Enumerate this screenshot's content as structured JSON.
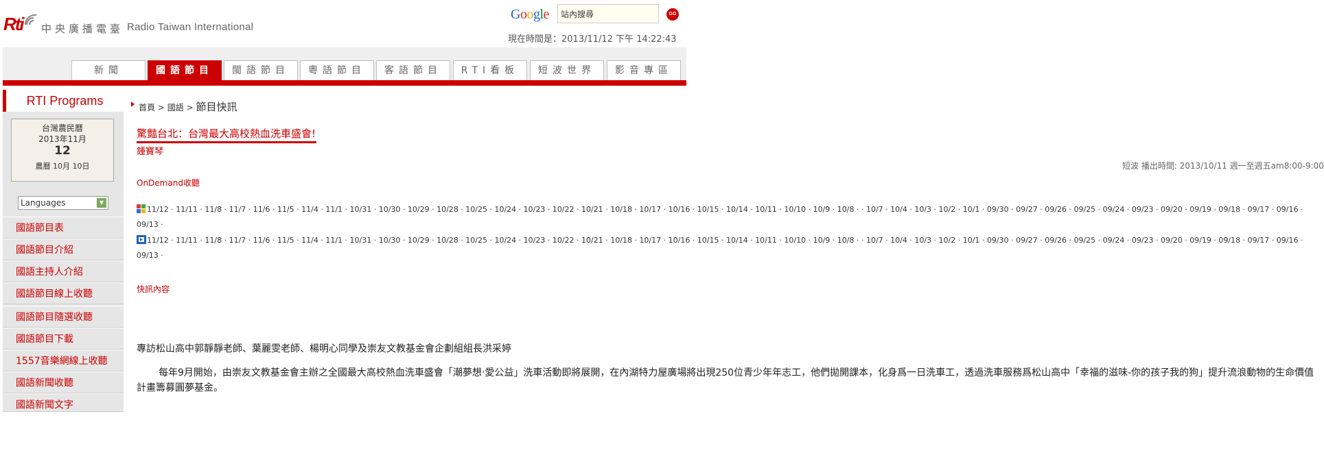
{
  "header": {
    "logo_text": "Rti",
    "site_name_cn": "中央廣播電臺",
    "site_name_en": "Radio Taiwan International",
    "google_logo": "Google",
    "search_value": "站內搜尋",
    "go_label": "GO",
    "time_label": "現在時間是：2013/11/12 下午 14:22:43"
  },
  "nav": {
    "tabs": [
      {
        "label": "新聞"
      },
      {
        "label": "國語節目"
      },
      {
        "label": "閩語節目"
      },
      {
        "label": "粵語節目"
      },
      {
        "label": "客語節目"
      },
      {
        "label": "RTI看板"
      },
      {
        "label": "短波世界"
      },
      {
        "label": "影音專區"
      }
    ],
    "active_tab": "國語節目"
  },
  "sidebar": {
    "title": "RTI Programs",
    "calendar": {
      "heading": "台灣農民曆",
      "date_line": "2013年11月",
      "day": "12",
      "lunar": "農曆 10月 10日"
    },
    "language_select": "Languages",
    "items": [
      {
        "label": "國語節目表"
      },
      {
        "label": "國語節目介紹"
      },
      {
        "label": "國語主持人介紹"
      },
      {
        "label": "國語節目線上收聽"
      },
      {
        "label": "國語節目隨選收聽"
      },
      {
        "label": "國語節目下載"
      },
      {
        "label": "1557音樂網線上收聽"
      },
      {
        "label": "國語新聞收聽"
      },
      {
        "label": "國語新聞文字"
      }
    ]
  },
  "main": {
    "breadcrumb": {
      "home": "首頁",
      "sep1": ">",
      "section": "國語",
      "sep2": ">",
      "current": "節目快訊"
    },
    "title": "驚豔台北：台灣最大高校熱血洗車盛會!",
    "host": "鍾寶琴",
    "broadcast_info": "短波 播出時間: 2013/10/11 週一至週五am8:00-9:00",
    "ondemand_label": "OnDemand收聽",
    "dates_row1": "11/12 · 11/11 · 11/8 · 11/7 · 11/6 · 11/5 · 11/4 · 11/1 · 10/31 · 10/30 · 10/29 · 10/28 · 10/25 · 10/24 · 10/23 · 10/22 · 10/21 · 10/18 · 10/17 · 10/16 · 10/15 · 10/14 · 10/11 · 10/10 · 10/9 · 10/8 · · 10/7 · 10/4 · 10/3 · 10/2 · 10/1 · 09/30 · 09/27 · 09/26 · 09/25 · 09/24 · 09/23 · 09/20 · 09/19 · 09/18 · 09/17 · 09/16 · 09/13 ·",
    "dates_row2": "11/12 · 11/11 · 11/8 · 11/7 · 11/6 · 11/5 · 11/4 · 11/1 · 10/31 · 10/30 · 10/29 · 10/28 · 10/25 · 10/24 · 10/23 · 10/22 · 10/21 · 10/18 · 10/17 · 10/16 · 10/15 · 10/14 · 10/11 · 10/10 · 10/9 · 10/8 · · 10/7 · 10/4 · 10/3 · 10/2 · 10/1 · 09/30 · 09/27 · 09/26 · 09/25 · 09/24 · 09/23 · 09/20 · 09/19 · 09/18 · 09/17 · 09/16 · 09/13 ·",
    "news_label": "快訊內容",
    "interview_line": "專訪松山高中郭靜靜老師、葉麗雯老師、楊明心同學及崇友文教基金會企劃組組長洪采婷",
    "paragraph": "每年9月開始，由崇友文教基金會主辦之全國最大高校熱血洗車盛會「潮夢想‧愛公益」洗車活動即將展開，在內湖特力屋廣場將出現250位青少年年志工，他們拋開課本，化身爲一日洗車工，透過洗車服務爲松山高中「幸福的滋味-你的孩子我的狗」提升流浪動物的生命價值計畫籌募圓夢基金。"
  },
  "colors": {
    "brand_red": "#cc0000",
    "nav_bg": "#efefef",
    "sidebar_bg": "#e6e6e6"
  }
}
